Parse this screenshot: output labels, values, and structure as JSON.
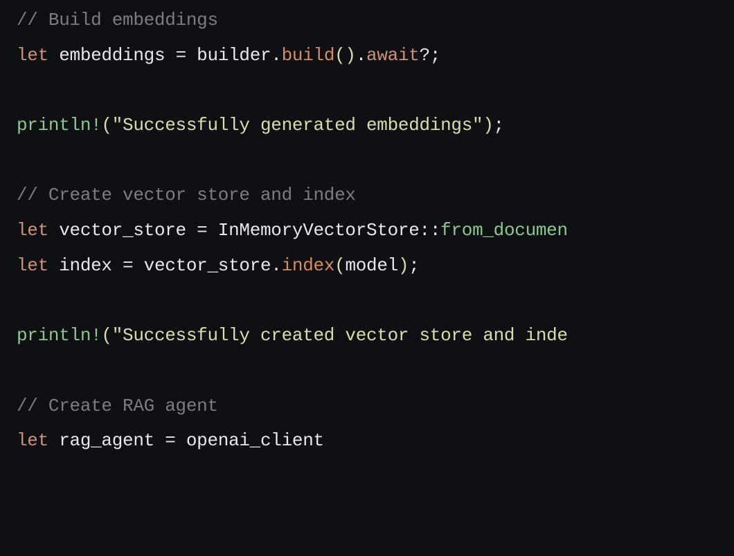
{
  "code": {
    "line1": {
      "comment": "// Build embeddings"
    },
    "line2": {
      "let": "let",
      "var": " embeddings ",
      "eq": "=",
      "sp1": " builder",
      "dot1": ".",
      "build": "build",
      "paren1": "()",
      "dot2": ".",
      "await": "await",
      "qm": "?",
      "semi": ";"
    },
    "line3": {
      "blank": ""
    },
    "line4": {
      "macro": "println!",
      "open": "(",
      "str": "\"Successfully generated embeddings\"",
      "close": ")",
      "semi": ";"
    },
    "line5": {
      "blank": ""
    },
    "line6": {
      "comment": "// Create vector store and index"
    },
    "line7": {
      "let": "let",
      "var": " vector_store ",
      "eq": "=",
      "sp1": " InMemoryVectorStore",
      "colons": "::",
      "method": "from_documen"
    },
    "line8": {
      "let": "let",
      "var": " index ",
      "eq": "=",
      "sp1": " vector_store",
      "dot1": ".",
      "method": "index",
      "open": "(",
      "arg": "model",
      "close": ")",
      "semi": ";"
    },
    "line9": {
      "blank": ""
    },
    "line10": {
      "macro": "println!",
      "open": "(",
      "str": "\"Successfully created vector store and inde",
      "close": "",
      "semi": ""
    },
    "line11": {
      "blank": ""
    },
    "line12": {
      "comment": "// Create RAG agent"
    },
    "line13": {
      "let": "let",
      "var": " rag_agent ",
      "eq": "=",
      "sp1": " openai_client"
    }
  }
}
